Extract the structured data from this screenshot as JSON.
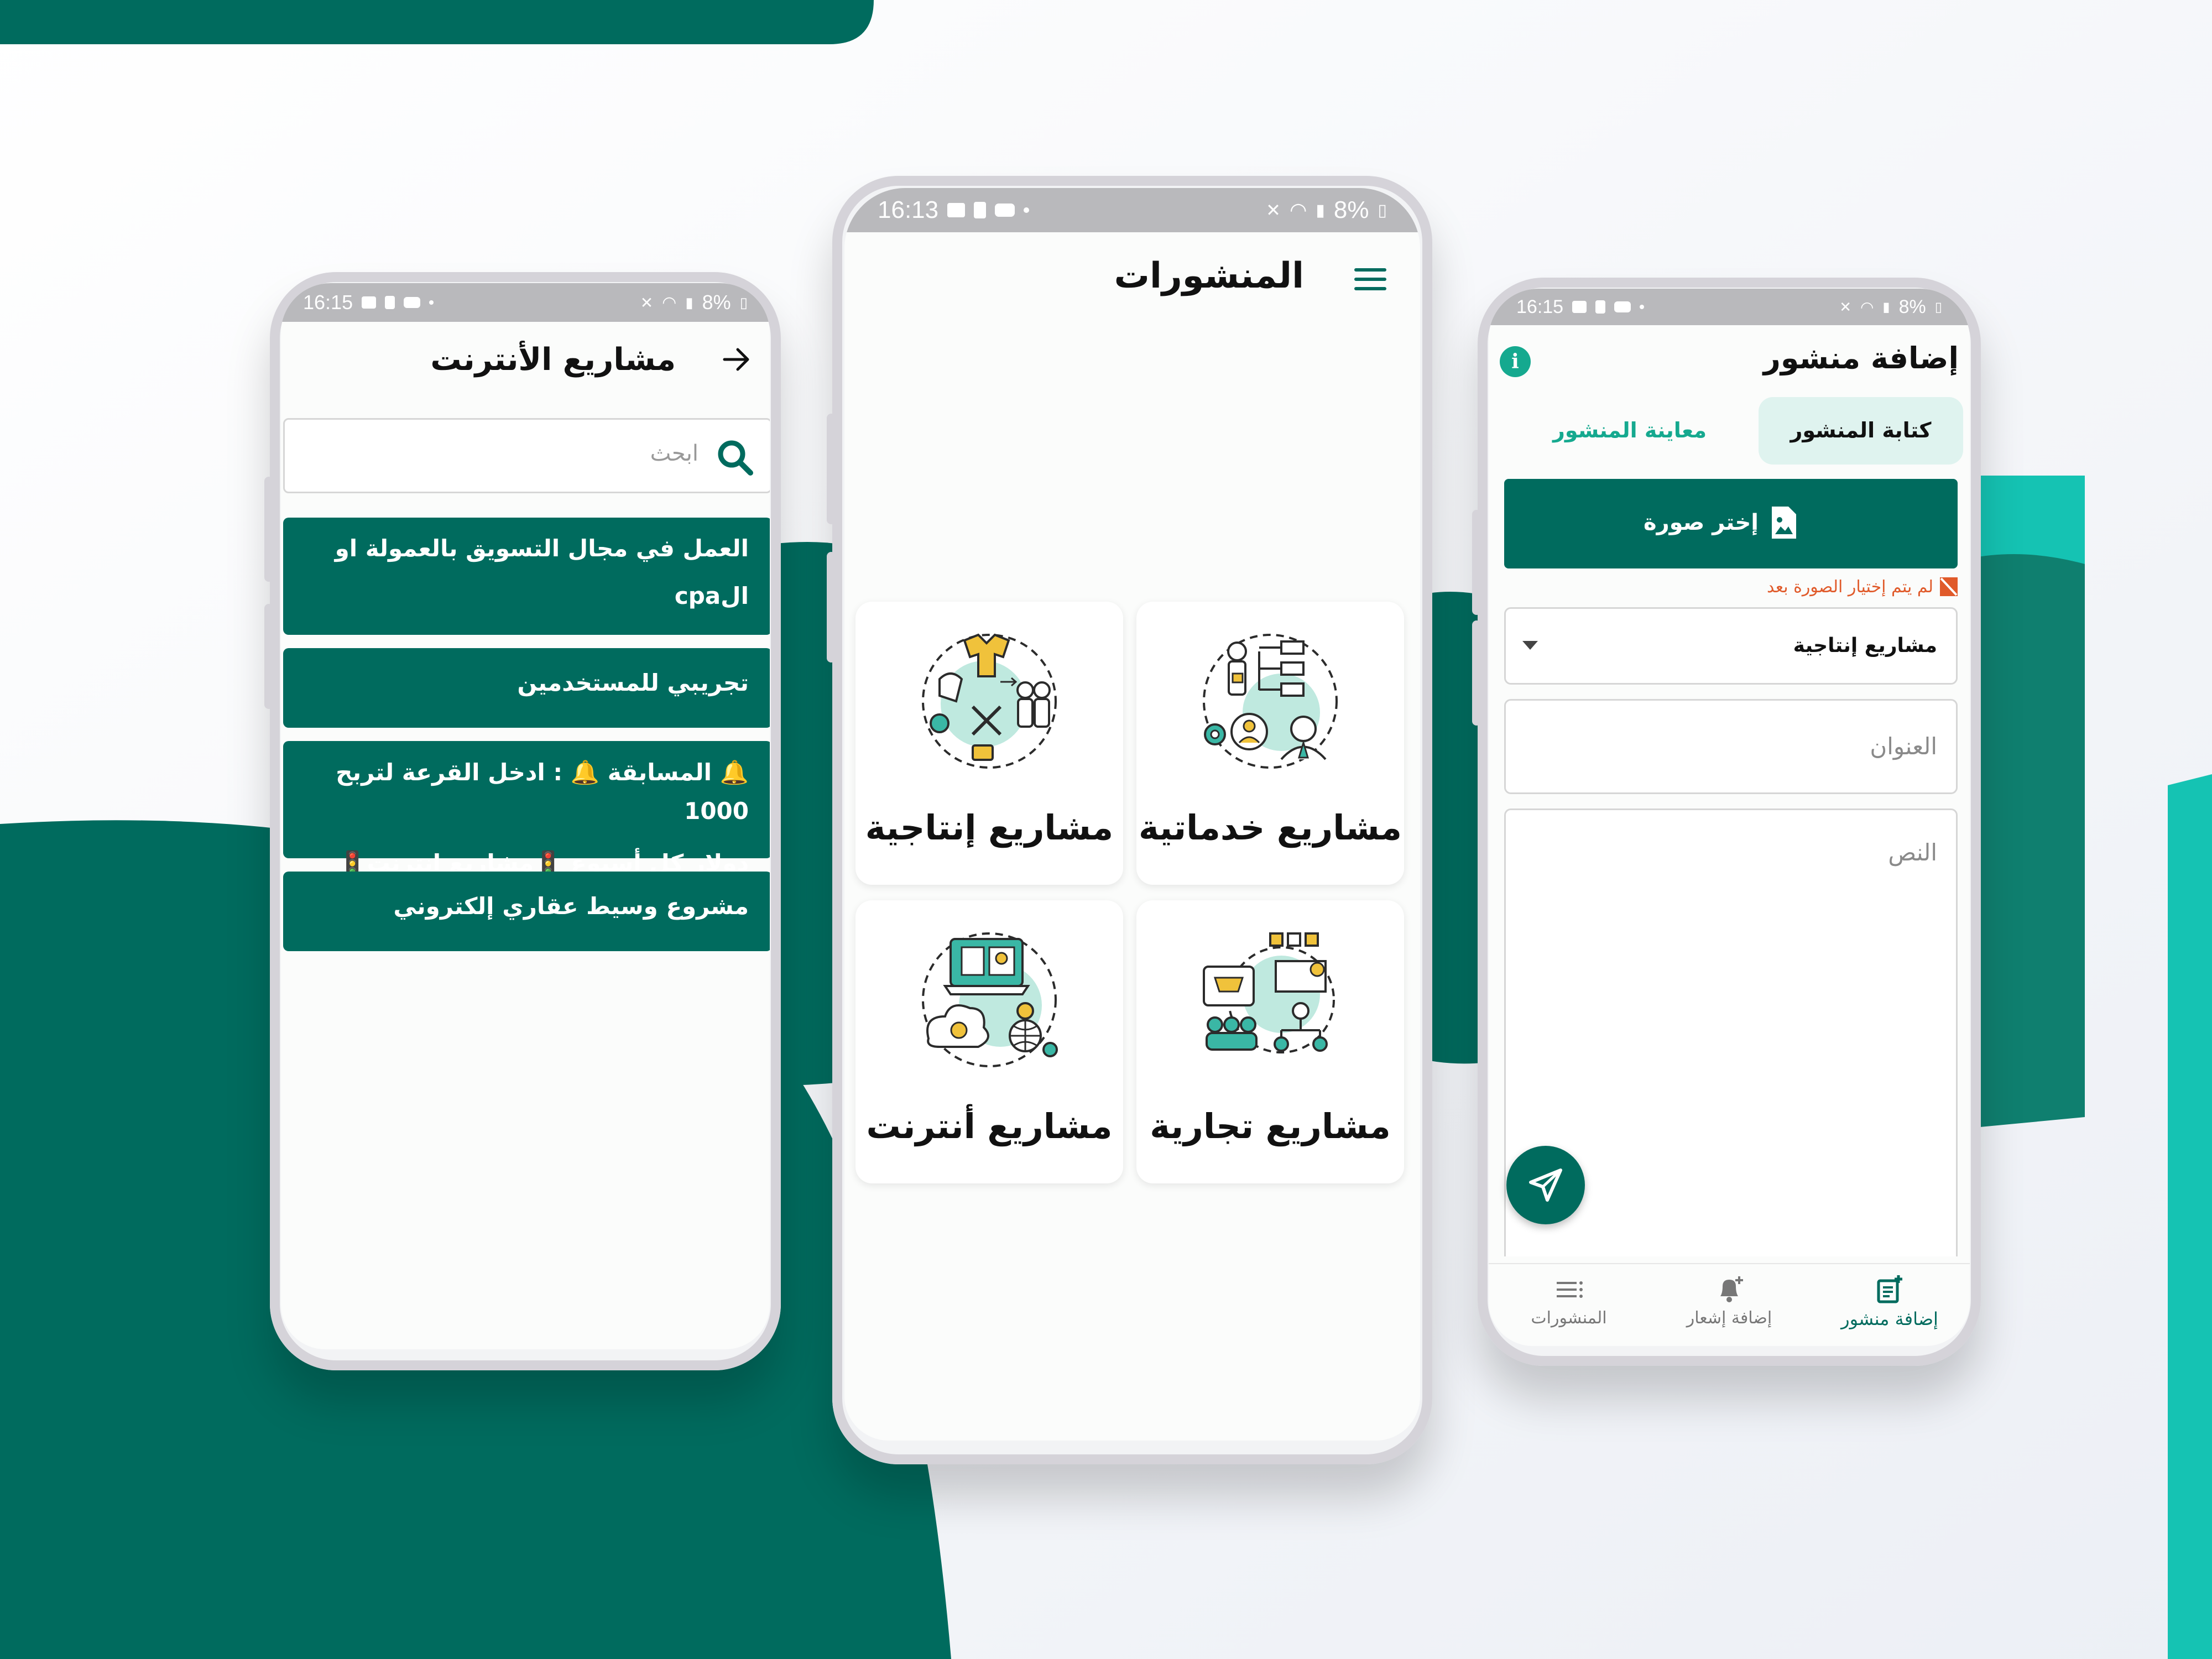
{
  "colors": {
    "brand": "#006b5e",
    "accent": "#15c3b3",
    "status_gray": "#b9b9bc",
    "error": "#e05a2a"
  },
  "left_phone": {
    "status": {
      "time": "16:15",
      "battery": "8%"
    },
    "header": {
      "title": "مشاريع الأنترنت",
      "back_icon": "arrow-right-icon"
    },
    "search": {
      "placeholder": "ابحث",
      "icon": "search-icon"
    },
    "posts": [
      {
        "line1": "العمل في مجال التسويق بالعمولة او",
        "line2": "الcpa"
      },
      {
        "line1": "تجريبي للمستخدمين"
      },
      {
        "line1": "🔔 المسابقة 🔔 : ادخل القرعة لتربح 1000",
        "line2": "دولار كل أسبوع 🚦مشاريع إنترنت🚦"
      },
      {
        "line1": "مشروع وسيط عقاري إلكتروني"
      }
    ]
  },
  "center_phone": {
    "status": {
      "time": "16:13",
      "battery": "8%"
    },
    "header": {
      "title": "المنشورات",
      "menu_icon": "menu-icon"
    },
    "categories": [
      {
        "label": "مشاريع خدماتية",
        "icon": "service-projects-icon"
      },
      {
        "label": "مشاريع إنتاجية",
        "icon": "production-projects-icon"
      },
      {
        "label": "مشاريع تجارية",
        "icon": "commercial-projects-icon"
      },
      {
        "label": "مشاريع أنترنت",
        "icon": "internet-projects-icon"
      }
    ]
  },
  "right_phone": {
    "status": {
      "time": "16:15",
      "battery": "8%"
    },
    "header": {
      "title": "إضافة منشور",
      "info_icon": "info-icon"
    },
    "tabs": {
      "write": "كتابة المنشور",
      "preview": "معاينة المنشور"
    },
    "choose_image": {
      "label": "إختر صورة",
      "icon": "image-file-icon"
    },
    "error": "لم يتم إختيار الصورة بعد",
    "category_select": {
      "value": "مشاريع إنتاجية"
    },
    "title_field": {
      "placeholder": "العنوان"
    },
    "body_field": {
      "placeholder": "النص"
    },
    "send_icon": "send-icon",
    "bottom_nav": [
      {
        "label": "إضافة منشور",
        "icon": "add-post-icon",
        "active": true
      },
      {
        "label": "إضافة إشعار",
        "icon": "add-notification-icon",
        "active": false
      },
      {
        "label": "المنشورات",
        "icon": "list-icon",
        "active": false
      }
    ]
  }
}
